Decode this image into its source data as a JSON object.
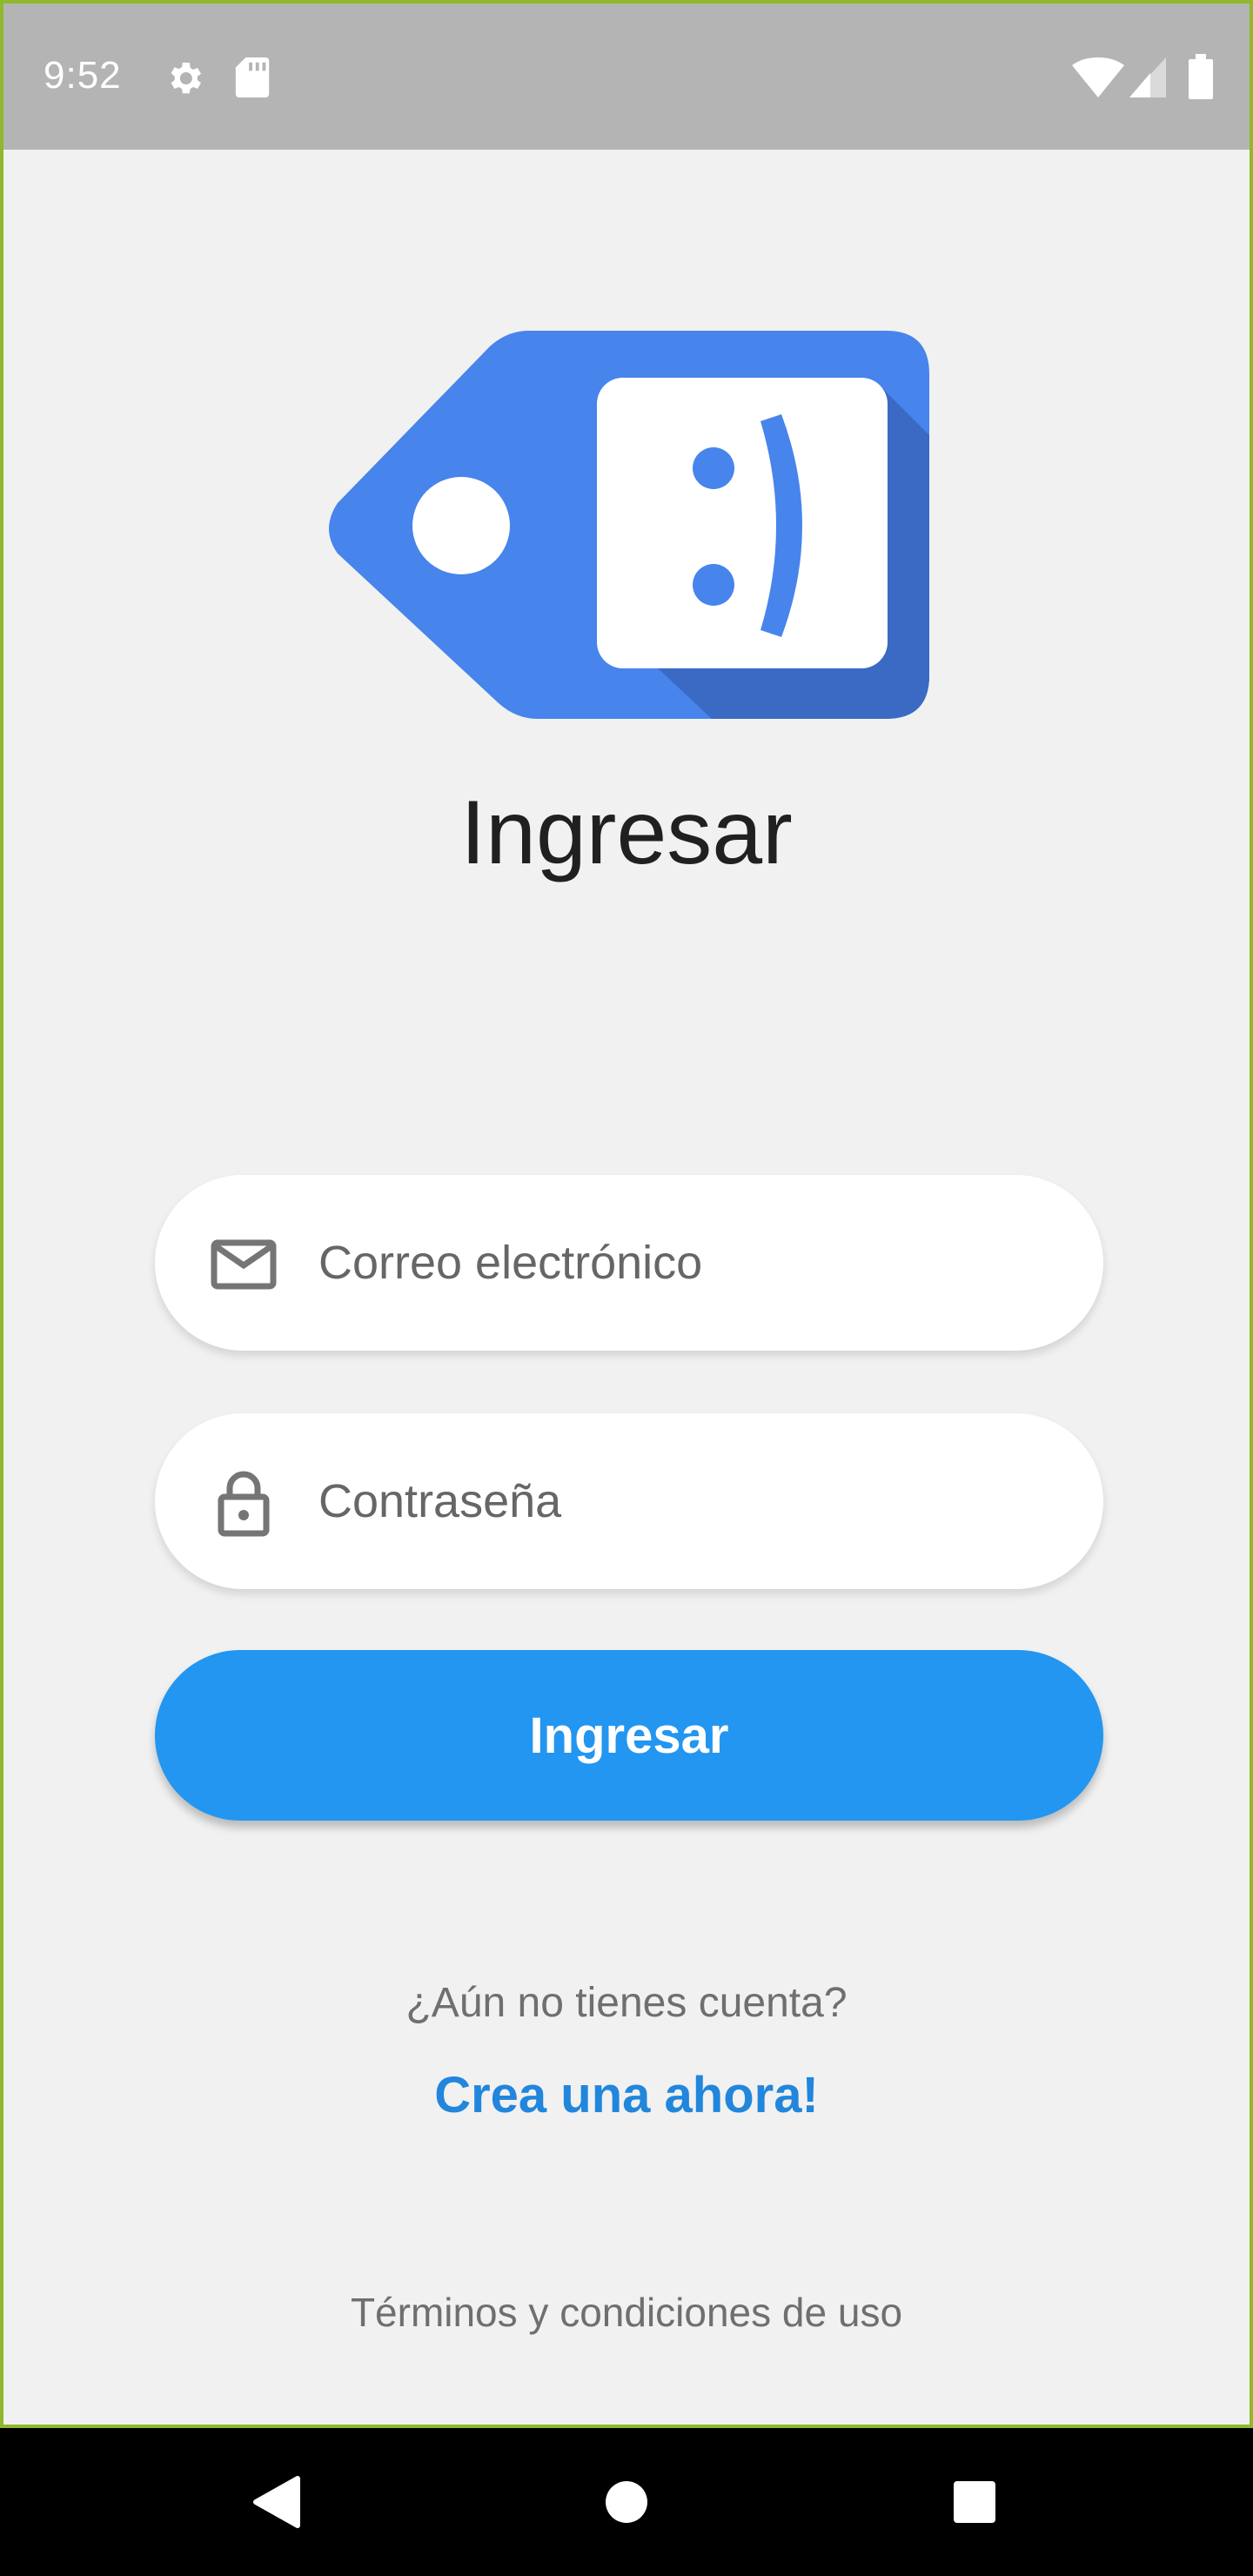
{
  "status_bar": {
    "time": "9:52",
    "icons": [
      "settings-icon",
      "sd-card-icon",
      "wifi-icon",
      "cellular-signal-icon",
      "battery-icon"
    ],
    "color": "#b4b4b4"
  },
  "logo": {
    "name": "price-tag-smiley-logo",
    "glyph": ":)",
    "primary_color": "#4784ec",
    "shadow_color": "#3a6ac4"
  },
  "login": {
    "title": "Ingresar",
    "email": {
      "placeholder": "Correo electrónico",
      "value": "",
      "icon": "envelope-icon"
    },
    "password": {
      "placeholder": "Contraseña",
      "value": "",
      "icon": "lock-icon"
    },
    "submit_label": "Ingresar",
    "submit_color": "#2296f0"
  },
  "signup": {
    "prompt": "¿Aún no tienes cuenta?",
    "link_label": "Crea una ahora!",
    "link_color": "#2186dc"
  },
  "footer": {
    "terms_label": "Términos y condiciones de uso"
  },
  "nav_bar": {
    "buttons": [
      "back-icon",
      "home-icon",
      "recents-icon"
    ]
  }
}
